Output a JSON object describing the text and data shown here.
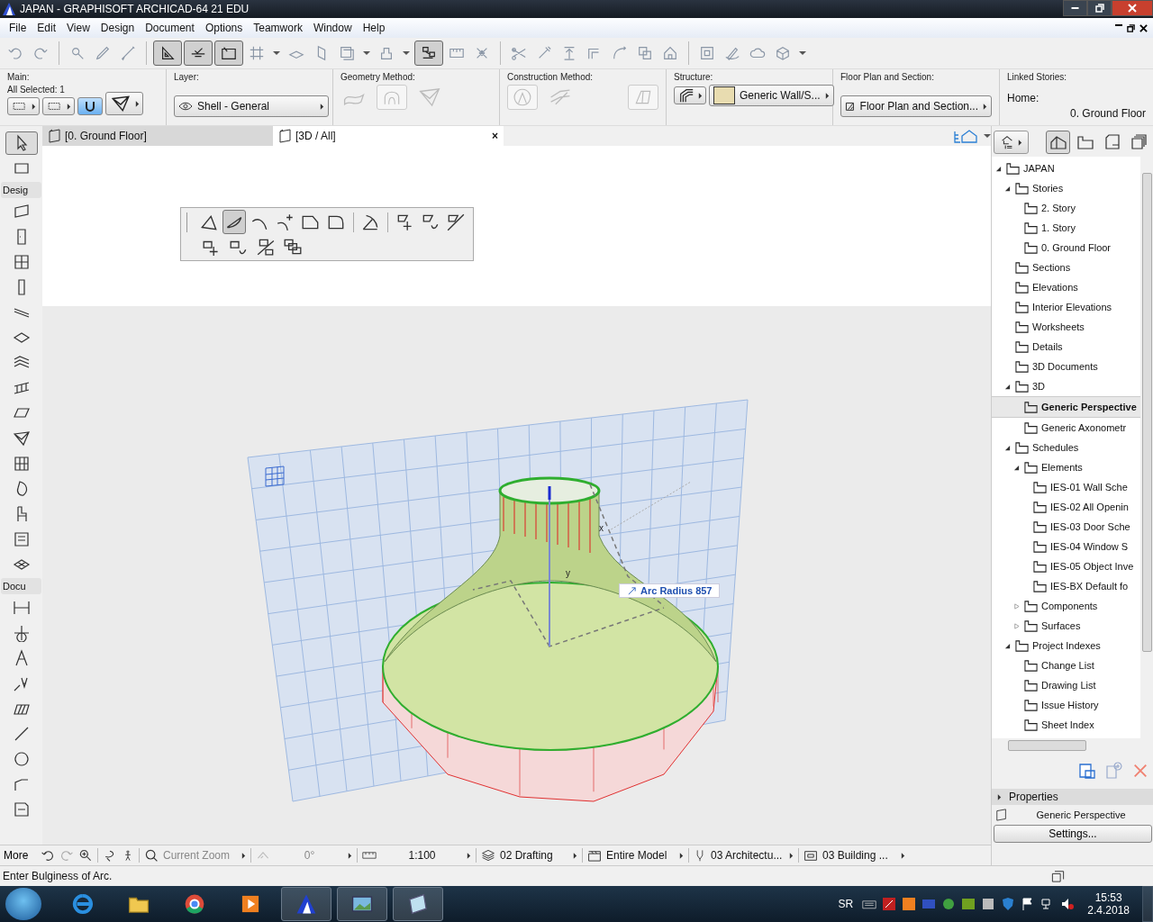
{
  "window": {
    "title": "JAPAN - GRAPHISOFT ARCHICAD-64 21 EDU"
  },
  "menu": [
    {
      "label": "File"
    },
    {
      "label": "Edit"
    },
    {
      "label": "View"
    },
    {
      "label": "Design"
    },
    {
      "label": "Document"
    },
    {
      "label": "Options"
    },
    {
      "label": "Teamwork"
    },
    {
      "label": "Window"
    },
    {
      "label": "Help"
    }
  ],
  "toolbar": [
    {
      "kind": "undo",
      "pressed": false
    },
    {
      "kind": "redo",
      "pressed": false
    },
    {
      "kind": "sep"
    },
    {
      "kind": "find",
      "pressed": false
    },
    {
      "kind": "dropper",
      "pressed": false
    },
    {
      "kind": "syringe",
      "pressed": false
    },
    {
      "kind": "sep"
    },
    {
      "kind": "ruler",
      "pressed": true
    },
    {
      "kind": "guide",
      "pressed": true
    },
    {
      "kind": "coords",
      "pressed": true
    },
    {
      "kind": "grid",
      "pressed": false
    },
    {
      "kind": "caret"
    },
    {
      "kind": "plane",
      "pressed": false
    },
    {
      "kind": "wallplane",
      "pressed": false
    },
    {
      "kind": "layers",
      "pressed": false
    },
    {
      "kind": "caret"
    },
    {
      "kind": "figure",
      "pressed": false
    },
    {
      "kind": "caret"
    },
    {
      "kind": "snap",
      "pressed": true
    },
    {
      "kind": "measure",
      "pressed": false
    },
    {
      "kind": "cross",
      "pressed": false
    },
    {
      "kind": "sep"
    },
    {
      "kind": "scissors",
      "pressed": false
    },
    {
      "kind": "magic",
      "pressed": false
    },
    {
      "kind": "elevate",
      "pressed": false
    },
    {
      "kind": "offset",
      "pressed": false
    },
    {
      "kind": "fillet",
      "pressed": false
    },
    {
      "kind": "resize",
      "pressed": false
    },
    {
      "kind": "home",
      "pressed": false
    },
    {
      "kind": "sep"
    },
    {
      "kind": "group",
      "pressed": false
    },
    {
      "kind": "pen",
      "pressed": false
    },
    {
      "kind": "cloud",
      "pressed": false
    },
    {
      "kind": "cube",
      "pressed": false
    },
    {
      "kind": "caret"
    }
  ],
  "info_box": {
    "main": {
      "label": "Main:",
      "selection": "All Selected: 1"
    },
    "layer": {
      "label": "Layer:",
      "value": "Shell - General"
    },
    "geometry": {
      "label": "Geometry Method:"
    },
    "construction": {
      "label": "Construction Method:"
    },
    "structure": {
      "label": "Structure:",
      "value": "Generic Wall/S..."
    },
    "floor_plan": {
      "label": "Floor Plan and Section:",
      "value": "Floor Plan and Section..."
    },
    "linked_stories": {
      "label": "Linked Stories:",
      "home_label": "Home:",
      "home_value": "0. Ground Floor"
    }
  },
  "tabs": [
    {
      "label": "[0. Ground Floor]",
      "selected": false
    },
    {
      "label": "[3D / All]",
      "selected": true
    }
  ],
  "tab_close": "×",
  "toolbox": [
    {
      "kind": "pointer",
      "selected": true
    },
    {
      "kind": "marquee",
      "selected": false
    },
    {
      "kind": "section",
      "label": "Desig",
      "selected": false
    },
    {
      "kind": "wall",
      "selected": false
    },
    {
      "kind": "door",
      "selected": false
    },
    {
      "kind": "window",
      "selected": false
    },
    {
      "kind": "column",
      "selected": false
    },
    {
      "kind": "beam",
      "selected": false
    },
    {
      "kind": "slab",
      "selected": false
    },
    {
      "kind": "stair",
      "selected": false
    },
    {
      "kind": "railing",
      "selected": false
    },
    {
      "kind": "roof",
      "selected": false
    },
    {
      "kind": "shell",
      "selected": false
    },
    {
      "kind": "curtain",
      "selected": false
    },
    {
      "kind": "morph",
      "selected": false
    },
    {
      "kind": "object",
      "selected": false
    },
    {
      "kind": "zone",
      "selected": false
    },
    {
      "kind": "mesh",
      "selected": false
    },
    {
      "kind": "section",
      "label": "Docu",
      "selected": false
    },
    {
      "kind": "dimension",
      "selected": false
    },
    {
      "kind": "level",
      "selected": false
    },
    {
      "kind": "text",
      "selected": false
    },
    {
      "kind": "label",
      "selected": false
    },
    {
      "kind": "fill",
      "selected": false
    },
    {
      "kind": "line",
      "selected": false
    },
    {
      "kind": "circle",
      "selected": false
    },
    {
      "kind": "polyline",
      "selected": false
    },
    {
      "kind": "drawing",
      "selected": false
    }
  ],
  "more": "More",
  "pet_palette": [
    {
      "kind": "pt-polygon",
      "selected": false
    },
    {
      "kind": "pt-arc",
      "selected": true
    },
    {
      "kind": "pt-curve",
      "selected": false
    },
    {
      "kind": "pt-add",
      "selected": false
    },
    {
      "kind": "pt-chamfer",
      "selected": false
    },
    {
      "kind": "pt-fillet",
      "selected": false
    },
    {
      "kind": "sep"
    },
    {
      "kind": "pt-rotate",
      "selected": false
    },
    {
      "kind": "sep"
    },
    {
      "kind": "pt-move",
      "selected": false
    },
    {
      "kind": "pt-swap",
      "selected": false
    },
    {
      "kind": "pt-split",
      "selected": false
    },
    {
      "kind": "row"
    },
    {
      "kind": "pt-boxmove",
      "selected": false
    },
    {
      "kind": "pt-boxswap",
      "selected": false
    },
    {
      "kind": "pt-boxsplit",
      "selected": false
    },
    {
      "kind": "pt-boxstack",
      "selected": false
    }
  ],
  "viewport": {
    "tooltip": "Arc Radius 857",
    "axis_labels": [
      "x",
      "y"
    ]
  },
  "navigator": {
    "tree": [
      {
        "label": "JAPAN",
        "expanded": true,
        "selected": false,
        "children": [
          {
            "label": "Stories",
            "expanded": true,
            "selected": false,
            "children": [
              {
                "label": "2. Story",
                "selected": false
              },
              {
                "label": "1. Story",
                "selected": false
              },
              {
                "label": "0. Ground Floor",
                "selected": false
              }
            ]
          },
          {
            "label": "Sections",
            "selected": false
          },
          {
            "label": "Elevations",
            "selected": false
          },
          {
            "label": "Interior Elevations",
            "selected": false
          },
          {
            "label": "Worksheets",
            "selected": false
          },
          {
            "label": "Details",
            "selected": false
          },
          {
            "label": "3D Documents",
            "selected": false
          },
          {
            "label": "3D",
            "expanded": true,
            "selected": false,
            "children": [
              {
                "label": "Generic Perspective",
                "selected": true
              },
              {
                "label": "Generic Axonometr",
                "selected": false
              }
            ]
          },
          {
            "label": "Schedules",
            "expanded": true,
            "selected": false,
            "children": [
              {
                "label": "Elements",
                "expanded": true,
                "selected": false,
                "children": [
                  {
                    "label": "IES-01 Wall Sche",
                    "selected": false
                  },
                  {
                    "label": "IES-02 All Openin",
                    "selected": false
                  },
                  {
                    "label": "IES-03 Door Sche",
                    "selected": false
                  },
                  {
                    "label": "IES-04 Window S",
                    "selected": false
                  },
                  {
                    "label": "IES-05 Object Inve",
                    "selected": false
                  },
                  {
                    "label": "IES-BX Default fo",
                    "selected": false
                  }
                ]
              },
              {
                "label": "Components",
                "expanded": false,
                "selected": false
              },
              {
                "label": "Surfaces",
                "expanded": false,
                "selected": false
              }
            ]
          },
          {
            "label": "Project Indexes",
            "expanded": true,
            "selected": false,
            "children": [
              {
                "label": "Change List",
                "selected": false
              },
              {
                "label": "Drawing List",
                "selected": false
              },
              {
                "label": "Issue History",
                "selected": false
              },
              {
                "label": "Sheet Index",
                "selected": false
              }
            ]
          }
        ]
      }
    ],
    "properties": {
      "title": "Properties",
      "view": "Generic Perspective",
      "button": "Settings..."
    }
  },
  "status_bar": {
    "zoom": "Current Zoom",
    "angle": "0°",
    "scale": "1:100",
    "layer_combo": "02 Drafting",
    "model_filter": "Entire Model",
    "pen_set": "03 Architectu...",
    "view_options": "03 Building ..."
  },
  "message": "Enter Bulginess of Arc.",
  "taskbar": {
    "language": "SR",
    "time": "15:53",
    "date": "2.4.2018"
  }
}
